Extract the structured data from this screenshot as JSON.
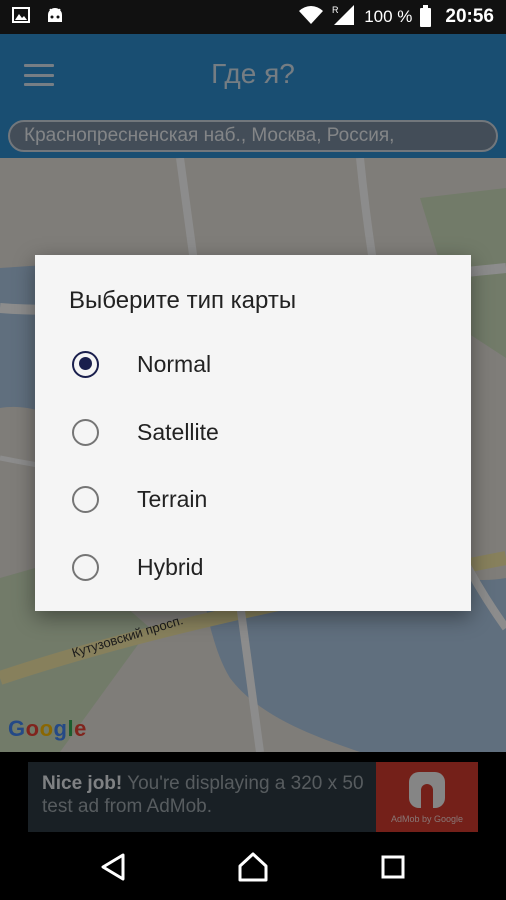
{
  "status_bar": {
    "battery": "100 %",
    "time": "20:56",
    "icons": [
      "image-notification-icon",
      "android-notification-icon",
      "wifi-icon",
      "signal-icon",
      "battery-icon"
    ]
  },
  "app_bar": {
    "title": "Где я?",
    "address": "Краснопресненская наб., Москва, Россия,"
  },
  "map": {
    "street_label": "Кутузовский просп.",
    "google_logo": [
      "G",
      "o",
      "o",
      "g",
      "l",
      "e"
    ]
  },
  "ad": {
    "headline": "Nice job!",
    "body": " You're displaying a 320 x 50 test ad from AdMob.",
    "brand": "AdMob by Google"
  },
  "dialog": {
    "title": "Выберите тип карты",
    "options": [
      {
        "label": "Normal",
        "checked": true
      },
      {
        "label": "Satellite",
        "checked": false
      },
      {
        "label": "Terrain",
        "checked": false
      },
      {
        "label": "Hybrid",
        "checked": false
      }
    ]
  },
  "colors": {
    "app_bar": "#2e8ed0",
    "radio_selected": "#1a1f4d",
    "ad_background": "#2f3b44",
    "ad_logo": "#d33b2f"
  }
}
